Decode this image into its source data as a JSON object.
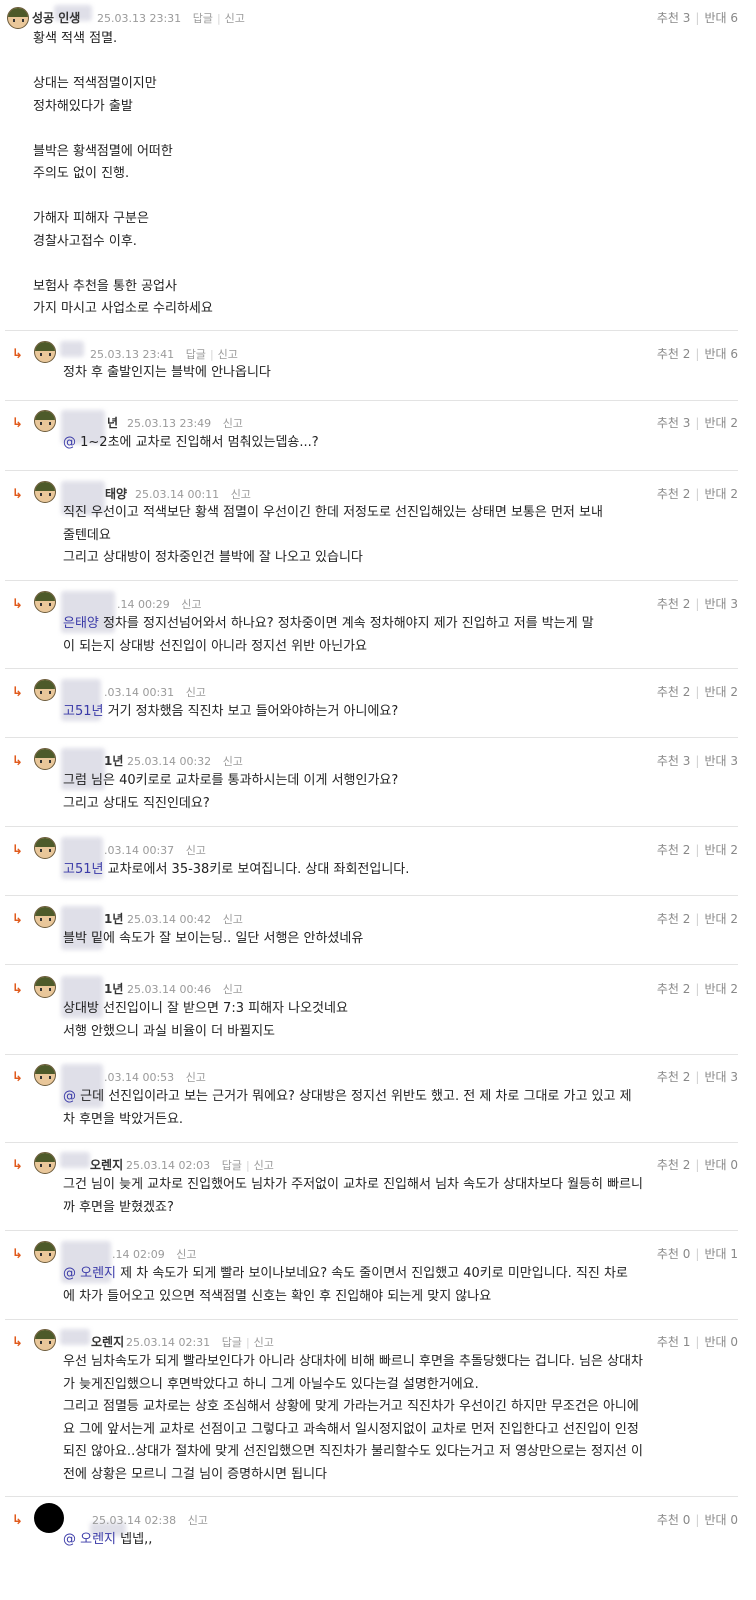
{
  "labels": {
    "reply": "답글",
    "report": "신고",
    "upvote": "추천",
    "downvote": "반대"
  },
  "comments": [
    {
      "author": "성공      인생",
      "date": "25.03.13 23:31",
      "has_reply": true,
      "up": "3",
      "down": "6",
      "lines": [
        "황색 적색 점멸.",
        "",
        "상대는 적색점멸이지만",
        "정차해있다가 출발",
        "",
        "블박은 황색점멸에 어떠한",
        "주의도 없이 진행.",
        "",
        "가해자 피해자 구분은",
        "경찰사고접수 이후.",
        "",
        "보험사 추천을 통한 공업사",
        "가지 마시고 사업소로 수리하세요"
      ]
    },
    {
      "author": "",
      "date": "25.03.13 23:41",
      "has_reply": true,
      "up": "2",
      "down": "6",
      "lines": [
        "정차 후 출발인지는 블박에 안나옵니다"
      ]
    },
    {
      "author": "년",
      "date": "25.03.13 23:49",
      "has_reply": false,
      "up": "3",
      "down": "2",
      "mention": "@",
      "lines": [
        "1~2초에 교차로 진입해서 멈춰있는뎁숑...?"
      ]
    },
    {
      "author": "태양",
      "date": "25.03.14 00:11",
      "has_reply": false,
      "up": "2",
      "down": "2",
      "lines": [
        "직진 우선이고 적색보단 황색 점멸이 우선이긴 한데 저정도로 선진입해있는 상태면 보통은 먼저 보내",
        "줄텐데요",
        "그리고 상대방이 정차중인건 블박에 잘 나오고 있습니다"
      ]
    },
    {
      "author": "",
      "date": ".14 00:29",
      "has_reply": false,
      "up": "2",
      "down": "3",
      "mention": "은태양",
      "lines": [
        "정차를 정지선넘어와서 하나요? 정차중이면 계속 정차해야지 제가 진입하고 저를 박는게 말",
        "이 되는지 상대방 선진입이 아니라 정지선 위반 아닌가요"
      ]
    },
    {
      "author": "",
      "date": ".03.14 00:31",
      "has_reply": false,
      "up": "2",
      "down": "2",
      "mention": "고51년",
      "lines": [
        "거기 정차했음 직진차 보고 들어와야하는거 아니에요?"
      ]
    },
    {
      "author": "1년",
      "date": "25.03.14 00:32",
      "has_reply": false,
      "up": "3",
      "down": "3",
      "lines": [
        "그럼 님은 40키로로 교차로를 통과하시는데 이게 서행인가요?",
        "그리고 상대도 직진인데요?"
      ]
    },
    {
      "author": "",
      "date": ".03.14 00:37",
      "has_reply": false,
      "up": "2",
      "down": "2",
      "mention": "고51년",
      "lines": [
        "교차로에서 35-38키로 보여집니다. 상대 좌회전입니다."
      ]
    },
    {
      "author": "1년",
      "date": "25.03.14 00:42",
      "has_reply": false,
      "up": "2",
      "down": "2",
      "lines": [
        "블박 밑에 속도가 잘 보이는딩.. 일단 서행은 안하셨네유"
      ]
    },
    {
      "author": "1년",
      "date": "25.03.14 00:46",
      "has_reply": false,
      "up": "2",
      "down": "2",
      "lines": [
        "상대방 선진입이니 잘 받으면 7:3 피해자 나오것네요",
        "서행 안했으니 과실 비율이 더 바뀔지도"
      ]
    },
    {
      "author": "",
      "date": ".03.14 00:53",
      "has_reply": false,
      "up": "2",
      "down": "3",
      "mention": "@",
      "lines": [
        "근데 선진입이라고 보는 근거가 뭐에요? 상대방은 정지선 위반도 했고. 전 제 차로 그대로 가고 있고 제",
        "차 후면을 박았거든요."
      ]
    },
    {
      "author": "오렌지",
      "date": "25.03.14 02:03",
      "has_reply": true,
      "up": "2",
      "down": "0",
      "lines": [
        "그건 님이 늦게 교차로 진입했어도 님차가 주저없이 교차로 진입해서 님차 속도가 상대차보다 월등히 빠르니",
        "까 후면을 받혔겠죠?"
      ]
    },
    {
      "author": "",
      "date": ".14 02:09",
      "has_reply": false,
      "up": "0",
      "down": "1",
      "mention": "@  오렌지",
      "lines": [
        "제 차 속도가 되게 빨라 보이나보네요? 속도 줄이면서 진입했고 40키로 미만입니다. 직진 차로",
        "에 차가 들어오고 있으면 적색점멸 신호는 확인 후 진입해야 되는게 맞지 않나요"
      ]
    },
    {
      "author": "오렌지",
      "date": "25.03.14 02:31",
      "has_reply": true,
      "up": "1",
      "down": "0",
      "lines": [
        "우선 님차속도가 되게 빨라보인다가 아니라 상대차에 비해 빠르니 후면을 추돌당했다는 겁니다. 님은 상대차",
        "가 늦게진입했으니 후면박았다고 하니 그게 아닐수도 있다는걸 설명한거에요.",
        "그리고 점멸등 교차로는 상호 조심해서 상황에 맞게 가라는거고 직진차가 우선이긴 하지만 무조건은 아니에",
        "요 그에 앞서는게 교차로 선점이고 그렇다고 과속해서 일시정지없이 교차로 먼저 진입한다고 선진입이 인정",
        "되진 않아요..상대가 절차에 맞게 선진입했으면 직진차가 불리할수도 있다는거고 저 영상만으로는 정지선 이",
        "전에 상황은 모르니 그걸 님이 증명하시면 됩니다"
      ]
    },
    {
      "author": "",
      "date": "25.03.14 02:38",
      "has_reply": false,
      "up": "0",
      "down": "0",
      "mention": "@      오렌지",
      "lines": [
        "넵넵,,"
      ]
    }
  ]
}
